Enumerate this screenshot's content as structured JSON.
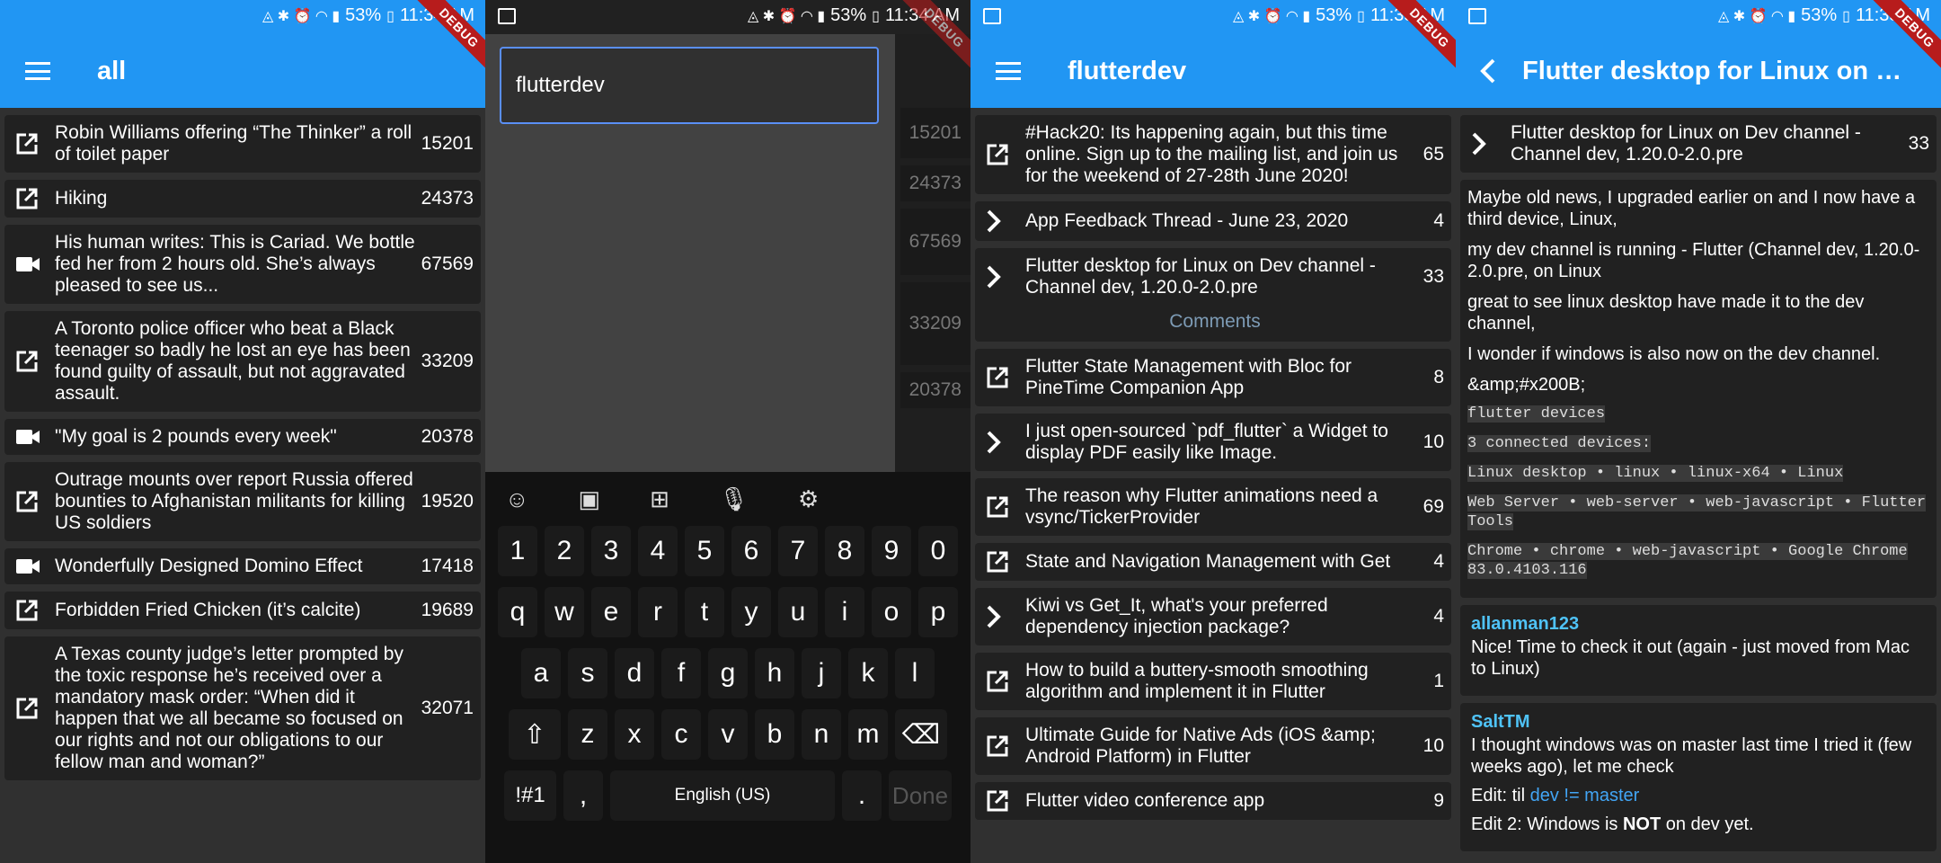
{
  "status": {
    "battery": "53%",
    "time_1": "11:34 AM",
    "time_2": "11:34 AM",
    "time_3": "11:35 AM",
    "time_4": "11:35 AM",
    "debug": "DEBUG"
  },
  "panel1": {
    "title": "all",
    "posts": [
      {
        "icon": "open-in-new-icon",
        "title": "Robin Williams offering “The Thinker” a roll of toilet paper",
        "count": "15201"
      },
      {
        "icon": "open-in-new-icon",
        "title": "Hiking",
        "count": "24373"
      },
      {
        "icon": "video-icon",
        "title": "His human writes: This is Cariad. We bottle fed her from 2 hours old. She’s always pleased to see us...",
        "count": "67569"
      },
      {
        "icon": "open-in-new-icon",
        "title": "A Toronto police officer who beat a Black teenager so badly he lost an eye has been found guilty of assault, but not aggravated assault.",
        "count": "33209"
      },
      {
        "icon": "video-icon",
        "title": "\"My goal is 2 pounds every week\"",
        "count": "20378"
      },
      {
        "icon": "open-in-new-icon",
        "title": "Outrage mounts over report Russia offered bounties to Afghanistan militants for killing US soldiers",
        "count": "19520"
      },
      {
        "icon": "video-icon",
        "title": "Wonderfully Designed Domino Effect",
        "count": "17418"
      },
      {
        "icon": "open-in-new-icon",
        "title": "Forbidden Fried Chicken (it’s calcite)",
        "count": "19689"
      },
      {
        "icon": "open-in-new-icon",
        "title": "A Texas county judge’s letter prompted by the toxic response he’s received over a mandatory mask order: “When did it happen that we all became so focused on our rights and not our obligations to our fellow man and woman?”",
        "count": "32071"
      }
    ]
  },
  "panel2": {
    "search_value": "flutterdev",
    "bg_counts": [
      "15201",
      "24373",
      "67569",
      "33209",
      "20378"
    ],
    "keyboard": {
      "row1": [
        "1",
        "2",
        "3",
        "4",
        "5",
        "6",
        "7",
        "8",
        "9",
        "0"
      ],
      "row2": [
        "q",
        "w",
        "e",
        "r",
        "t",
        "y",
        "u",
        "i",
        "o",
        "p"
      ],
      "row3": [
        "a",
        "s",
        "d",
        "f",
        "g",
        "h",
        "j",
        "k",
        "l"
      ],
      "row4": [
        "z",
        "x",
        "c",
        "v",
        "b",
        "n",
        "m"
      ],
      "symbols": "!#1",
      "comma": ",",
      "space": "English (US)",
      "period": ".",
      "done": "Done"
    }
  },
  "panel3": {
    "title": "flutterdev",
    "comments_label": "Comments",
    "posts": [
      {
        "icon": "open-in-new-icon",
        "title": "#Hack20: Its happening again, but this time online. Sign up to the mailing list, and join us for the weekend of 27-28th June 2020!",
        "count": "65"
      },
      {
        "icon": "chevron-right-icon",
        "title": "App Feedback Thread - June 23, 2020",
        "count": "4"
      },
      {
        "icon": "chevron-right-icon",
        "title": "Flutter desktop for Linux on Dev channel - Channel dev, 1.20.0-2.0.pre",
        "count": "33",
        "expanded": true
      },
      {
        "icon": "open-in-new-icon",
        "title": "Flutter State Management with Bloc for PineTime Companion App",
        "count": "8"
      },
      {
        "icon": "chevron-right-icon",
        "title": "I just open-sourced `pdf_flutter` a Widget to display PDF easily like Image.",
        "count": "10"
      },
      {
        "icon": "open-in-new-icon",
        "title": "The reason why Flutter animations need a vsync/TickerProvider",
        "count": "69"
      },
      {
        "icon": "open-in-new-icon",
        "title": "State and Navigation Management with Get",
        "count": "4"
      },
      {
        "icon": "chevron-right-icon",
        "title": "Kiwi vs Get_It, what's your preferred dependency injection package?",
        "count": "4"
      },
      {
        "icon": "open-in-new-icon",
        "title": "How to build a buttery-smooth smoothing algorithm and implement it in Flutter",
        "count": "1"
      },
      {
        "icon": "open-in-new-icon",
        "title": "Ultimate Guide for Native Ads (iOS &amp; Android Platform) in Flutter",
        "count": "10"
      },
      {
        "icon": "open-in-new-icon",
        "title": "Flutter video conference app",
        "count": "9"
      }
    ]
  },
  "panel4": {
    "title": "Flutter desktop for Linux on …",
    "post_title": "Flutter desktop for Linux on Dev channel - Channel dev, 1.20.0-2.0.pre",
    "post_count": "33",
    "body": [
      "Maybe old news, I upgraded earlier on and I now have a third device, Linux,",
      "my dev channel is running - Flutter (Channel dev, 1.20.0-2.0.pre, on Linux",
      "great to see linux desktop have made it to the dev channel,",
      "I wonder if windows is also now on the dev channel.",
      "&amp;#x200B;"
    ],
    "code": [
      "flutter devices",
      "3 connected devices:",
      "Linux desktop • linux • linux-x64 • Linux",
      "Web Server • web-server • web-javascript • Flutter Tools",
      "Chrome • chrome • web-javascript • Google Chrome 83.0.4103.116"
    ],
    "comments": [
      {
        "author": "allanman123",
        "text": "Nice! Time to check it out (again - just moved from Mac to Linux)"
      },
      {
        "author": "SaltTM",
        "text": "I thought windows was on master last time I tried it (few weeks ago), let me check",
        "edit1_prefix": "Edit: til ",
        "edit1_link": "dev != master",
        "edit2_prefix": "Edit 2: Windows is ",
        "edit2_bold": "NOT",
        "edit2_suffix": " on dev yet."
      }
    ]
  }
}
